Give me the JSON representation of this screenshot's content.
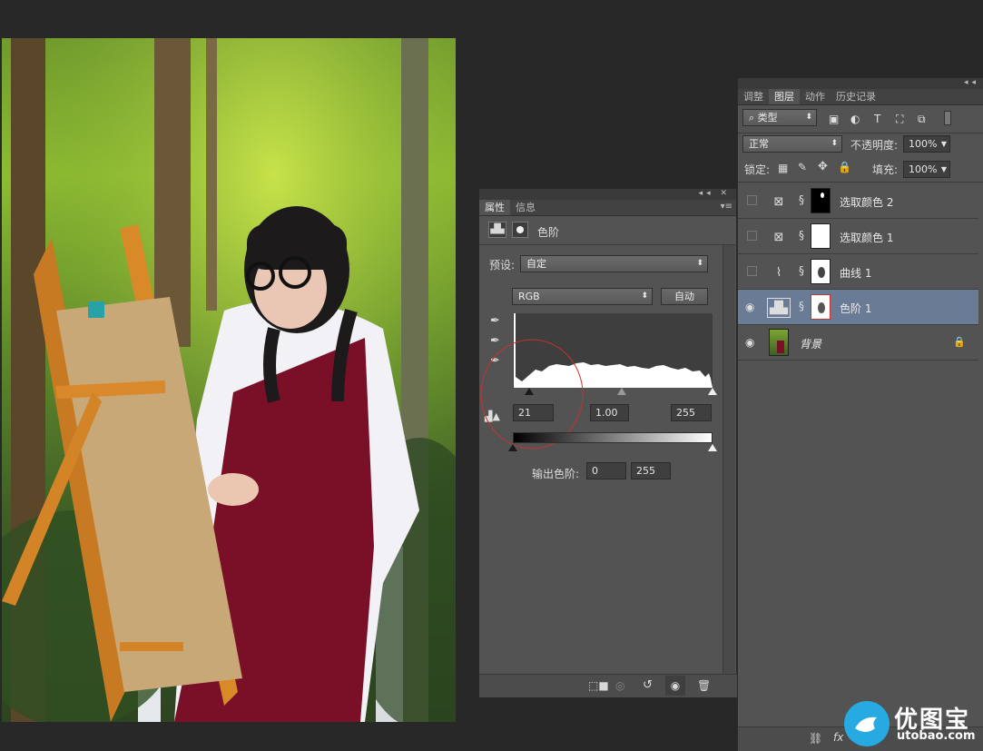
{
  "colors": {
    "workspace": "#282828",
    "panel": "#535353",
    "selected_layer": "#6a7c95",
    "accent_red": "#c8332f"
  },
  "properties_panel": {
    "tabs": [
      {
        "label": "属性",
        "active": true
      },
      {
        "label": "信息",
        "active": false
      }
    ],
    "header_title": "色阶",
    "preset_label": "预设:",
    "preset_value": "自定",
    "channel_value": "RGB",
    "auto_button": "自动",
    "input_black": "21",
    "input_gamma": "1.00",
    "input_white": "255",
    "output_label": "输出色阶:",
    "output_black": "0",
    "output_white": "255",
    "footer_icons": [
      "clip-to-layer-icon",
      "view-previous-icon",
      "reset-icon",
      "visibility-icon",
      "trash-icon"
    ]
  },
  "layers_panel": {
    "tabs": [
      {
        "label": "调整",
        "active": false
      },
      {
        "label": "图层",
        "active": true
      },
      {
        "label": "动作",
        "active": false
      },
      {
        "label": "历史记录",
        "active": false
      }
    ],
    "filter_label": "类型",
    "blend_mode": "正常",
    "opacity_label": "不透明度:",
    "opacity_value": "100%",
    "lock_label": "锁定:",
    "fill_label": "填充:",
    "fill_value": "100%",
    "layers": [
      {
        "name": "选取颜色 2",
        "visible": false,
        "selected": false,
        "icon": "selective-color-icon"
      },
      {
        "name": "选取颜色 1",
        "visible": false,
        "selected": false,
        "icon": "selective-color-icon"
      },
      {
        "name": "曲线 1",
        "visible": false,
        "selected": false,
        "icon": "curves-icon"
      },
      {
        "name": "色阶 1",
        "visible": true,
        "selected": true,
        "icon": "levels-icon"
      },
      {
        "name": "背景",
        "visible": true,
        "selected": false,
        "icon": "photo-thumbnail",
        "locked": true
      }
    ],
    "footer_icons": [
      "link-icon",
      "fx-icon"
    ]
  },
  "watermark": {
    "text": "优图宝",
    "url": "utobao.com"
  }
}
